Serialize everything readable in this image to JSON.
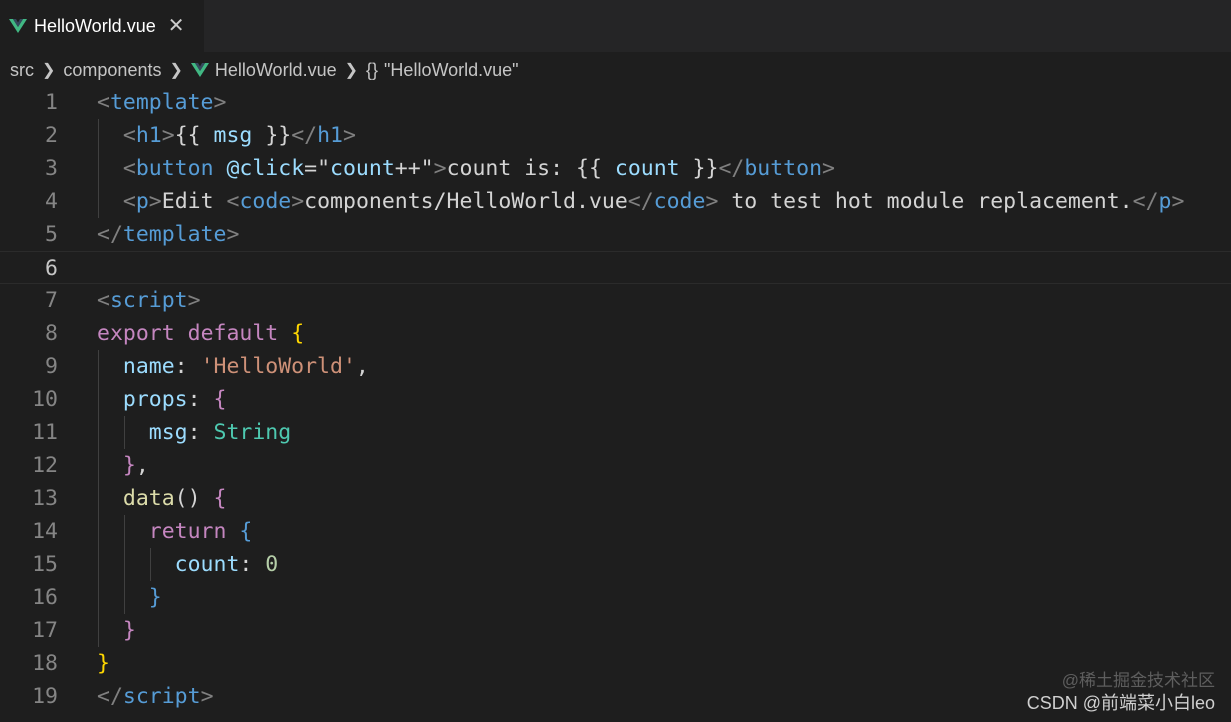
{
  "tab": {
    "label": "HelloWorld.vue",
    "close": "✕"
  },
  "breadcrumb": {
    "folder1": "src",
    "folder2": "components",
    "file": "HelloWorld.vue",
    "symbol": "\"HelloWorld.vue\""
  },
  "lines": [
    {
      "n": "1",
      "tokens": [
        [
          "t-tagb",
          "<"
        ],
        [
          "t-tag",
          "template"
        ],
        [
          "t-tagb",
          ">"
        ]
      ]
    },
    {
      "n": "2",
      "tokens": [
        [
          "t-text",
          "  "
        ],
        [
          "t-tagb",
          "<"
        ],
        [
          "t-tag",
          "h1"
        ],
        [
          "t-tagb",
          ">"
        ],
        [
          "t-mus",
          "{{ "
        ],
        [
          "t-attr",
          "msg"
        ],
        [
          "t-mus",
          " }}"
        ],
        [
          "t-tagb",
          "</"
        ],
        [
          "t-tag",
          "h1"
        ],
        [
          "t-tagb",
          ">"
        ]
      ]
    },
    {
      "n": "3",
      "tokens": [
        [
          "t-text",
          "  "
        ],
        [
          "t-tagb",
          "<"
        ],
        [
          "t-tag",
          "button"
        ],
        [
          "t-text",
          " "
        ],
        [
          "t-attr",
          "@click"
        ],
        [
          "t-text",
          "="
        ],
        [
          "t-text",
          "\""
        ],
        [
          "t-attr",
          "count"
        ],
        [
          "t-text",
          "++\""
        ],
        [
          "t-tagb",
          ">"
        ],
        [
          "t-text",
          "count is: "
        ],
        [
          "t-mus",
          "{{ "
        ],
        [
          "t-attr",
          "count"
        ],
        [
          "t-mus",
          " }}"
        ],
        [
          "t-tagb",
          "</"
        ],
        [
          "t-tag",
          "button"
        ],
        [
          "t-tagb",
          ">"
        ]
      ]
    },
    {
      "n": "4",
      "tokens": [
        [
          "t-text",
          "  "
        ],
        [
          "t-tagb",
          "<"
        ],
        [
          "t-tag",
          "p"
        ],
        [
          "t-tagb",
          ">"
        ],
        [
          "t-text",
          "Edit "
        ],
        [
          "t-tagb",
          "<"
        ],
        [
          "t-tag",
          "code"
        ],
        [
          "t-tagb",
          ">"
        ],
        [
          "t-text",
          "components/HelloWorld.vue"
        ],
        [
          "t-tagb",
          "</"
        ],
        [
          "t-tag",
          "code"
        ],
        [
          "t-tagb",
          ">"
        ],
        [
          "t-text",
          " to test hot module replacement."
        ],
        [
          "t-tagb",
          "</"
        ],
        [
          "t-tag",
          "p"
        ],
        [
          "t-tagb",
          ">"
        ]
      ]
    },
    {
      "n": "5",
      "tokens": [
        [
          "t-tagb",
          "</"
        ],
        [
          "t-tag",
          "template"
        ],
        [
          "t-tagb",
          ">"
        ]
      ]
    },
    {
      "n": "6",
      "tokens": []
    },
    {
      "n": "7",
      "tokens": [
        [
          "t-tagb",
          "<"
        ],
        [
          "t-tag",
          "script"
        ],
        [
          "t-tagb",
          ">"
        ]
      ]
    },
    {
      "n": "8",
      "tokens": [
        [
          "t-kw",
          "export"
        ],
        [
          "t-text",
          " "
        ],
        [
          "t-kw",
          "default"
        ],
        [
          "t-text",
          " "
        ],
        [
          "t-brace",
          "{"
        ]
      ]
    },
    {
      "n": "9",
      "tokens": [
        [
          "t-text",
          "  "
        ],
        [
          "t-prop",
          "name"
        ],
        [
          "t-punc",
          ": "
        ],
        [
          "t-str",
          "'HelloWorld'"
        ],
        [
          "t-punc",
          ","
        ]
      ]
    },
    {
      "n": "10",
      "tokens": [
        [
          "t-text",
          "  "
        ],
        [
          "t-prop",
          "props"
        ],
        [
          "t-punc",
          ": "
        ],
        [
          "t-kw",
          "{"
        ]
      ]
    },
    {
      "n": "11",
      "tokens": [
        [
          "t-text",
          "    "
        ],
        [
          "t-prop",
          "msg"
        ],
        [
          "t-punc",
          ": "
        ],
        [
          "t-type",
          "String"
        ]
      ]
    },
    {
      "n": "12",
      "tokens": [
        [
          "t-text",
          "  "
        ],
        [
          "t-kw",
          "}"
        ],
        [
          "t-punc",
          ","
        ]
      ]
    },
    {
      "n": "13",
      "tokens": [
        [
          "t-text",
          "  "
        ],
        [
          "t-fn",
          "data"
        ],
        [
          "t-punc",
          "() "
        ],
        [
          "t-kw",
          "{"
        ]
      ]
    },
    {
      "n": "14",
      "tokens": [
        [
          "t-text",
          "    "
        ],
        [
          "t-kw",
          "return"
        ],
        [
          "t-text",
          " "
        ],
        [
          "t-tag",
          "{"
        ]
      ]
    },
    {
      "n": "15",
      "tokens": [
        [
          "t-text",
          "      "
        ],
        [
          "t-prop",
          "count"
        ],
        [
          "t-punc",
          ": "
        ],
        [
          "t-num",
          "0"
        ]
      ]
    },
    {
      "n": "16",
      "tokens": [
        [
          "t-text",
          "    "
        ],
        [
          "t-tag",
          "}"
        ]
      ]
    },
    {
      "n": "17",
      "tokens": [
        [
          "t-text",
          "  "
        ],
        [
          "t-kw",
          "}"
        ]
      ]
    },
    {
      "n": "18",
      "tokens": [
        [
          "t-brace",
          "}"
        ]
      ]
    },
    {
      "n": "19",
      "tokens": [
        [
          "t-tagb",
          "</"
        ],
        [
          "t-tag",
          "script"
        ],
        [
          "t-tagb",
          ">"
        ]
      ]
    }
  ],
  "current_line": "6",
  "watermark": {
    "line1": "@稀土掘金技术社区",
    "line2": "CSDN @前端菜小白leo"
  },
  "colors": {
    "vue_green": "#41b883",
    "vue_dark": "#34495e",
    "editor_bg": "#1e1e1e"
  }
}
